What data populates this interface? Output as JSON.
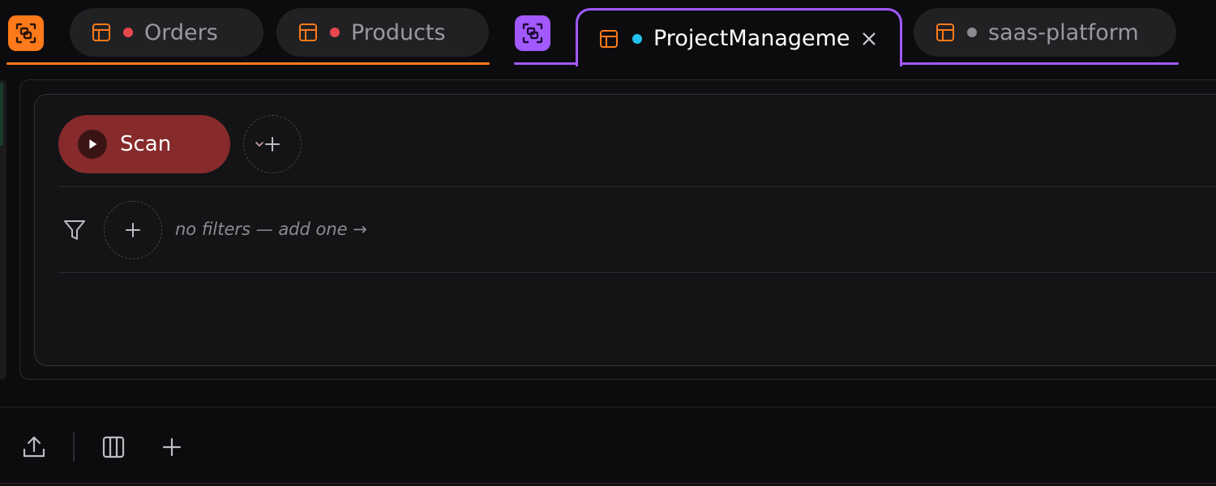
{
  "colors": {
    "group_orange": "#ff7a1a",
    "group_purple": "#a259ff",
    "dot_red": "#e5484d",
    "dot_cyan": "#22c3ee",
    "dot_grey": "#8a8a8e",
    "scan_bg": "#862a2b"
  },
  "tabs": [
    {
      "label": "Orders",
      "icon": "table-icon",
      "dot": "red"
    },
    {
      "label": "Products",
      "icon": "table-icon",
      "dot": "red"
    },
    {
      "label": "ProjectManagement",
      "icon": "table-icon",
      "dot": "cyan",
      "active": true
    },
    {
      "label": "saas-platform",
      "icon": "table-icon",
      "dot": "grey"
    }
  ],
  "group_icons": [
    "connection-group-icon-orange",
    "connection-group-icon-purple"
  ],
  "query": {
    "action_label": "Scan",
    "filter_hint": "no filters — add one →"
  },
  "toolbar": {
    "items": [
      "export-icon",
      "columns-icon",
      "add-icon"
    ]
  }
}
